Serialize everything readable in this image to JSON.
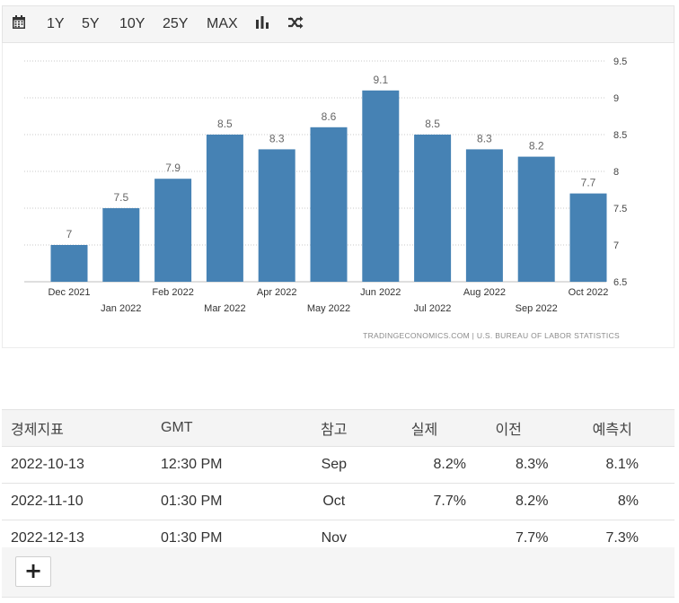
{
  "toolbar": {
    "calendar_icon": "calendar-icon",
    "ranges": [
      "1Y",
      "5Y",
      "10Y",
      "25Y",
      "MAX"
    ],
    "bar_chart_icon": "bar-chart-icon",
    "shuffle_icon": "shuffle-icon"
  },
  "chart_data": {
    "type": "bar",
    "categories": [
      "Dec 2021",
      "Jan 2022",
      "Feb 2022",
      "Mar 2022",
      "Apr 2022",
      "May 2022",
      "Jun 2022",
      "Jul 2022",
      "Aug 2022",
      "Sep 2022",
      "Oct 2022"
    ],
    "values": [
      7,
      7.5,
      7.9,
      8.5,
      8.3,
      8.6,
      9.1,
      8.5,
      8.3,
      8.2,
      7.7
    ],
    "value_labels": [
      "7",
      "7.5",
      "7.9",
      "8.5",
      "8.3",
      "8.6",
      "9.1",
      "8.5",
      "8.3",
      "8.2",
      "7.7"
    ],
    "ylim": [
      6.5,
      9.5
    ],
    "yticks": [
      6.5,
      7,
      7.5,
      8,
      8.5,
      9,
      9.5
    ],
    "ytick_labels": [
      "6.5",
      "7",
      "7.5",
      "8",
      "8.5",
      "9",
      "9.5"
    ],
    "y_axis_side": "right",
    "grid": true,
    "bar_color": "#4682b4",
    "source": "TRADINGECONOMICS.COM  |  U.S. BUREAU OF LABOR STATISTICS"
  },
  "table": {
    "headers": [
      "경제지표",
      "GMT",
      "참고",
      "실제",
      "이전",
      "예측치"
    ],
    "rows": [
      [
        "2022-10-13",
        "12:30 PM",
        "Sep",
        "8.2%",
        "8.3%",
        "8.1%"
      ],
      [
        "2022-11-10",
        "01:30 PM",
        "Oct",
        "7.7%",
        "8.2%",
        "8%"
      ],
      [
        "2022-12-13",
        "01:30 PM",
        "Nov",
        "",
        "7.7%",
        "7.3%"
      ]
    ]
  },
  "footer": {
    "add_label": "+"
  }
}
